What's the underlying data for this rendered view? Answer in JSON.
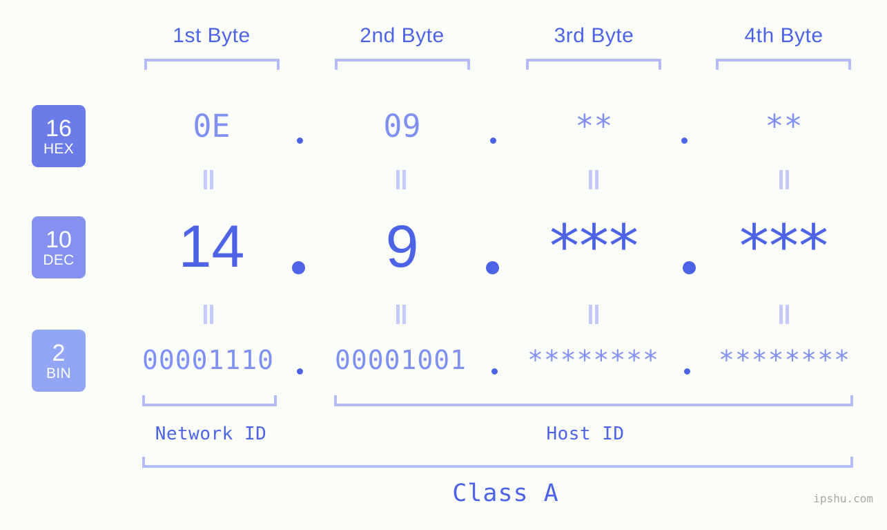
{
  "page": {
    "background_color": "#fbfdf8",
    "accent_strong": "#4d63e6",
    "accent_mid": "#8090f0",
    "accent_light": "#b3bcf9",
    "watermark": "ipshu.com"
  },
  "byte_headers": [
    {
      "label": "1st Byte"
    },
    {
      "label": "2nd Byte"
    },
    {
      "label": "3rd Byte"
    },
    {
      "label": "4th Byte"
    }
  ],
  "radix_badges": [
    {
      "number": "16",
      "name": "HEX",
      "color": "#6b7ce8"
    },
    {
      "number": "10",
      "name": "DEC",
      "color": "#8491ef"
    },
    {
      "number": "2",
      "name": "BIN",
      "color": "#93a6f5"
    }
  ],
  "rows": {
    "hex": {
      "values": [
        "0E",
        "09",
        "**",
        "**"
      ],
      "separator": "."
    },
    "dec": {
      "values": [
        "14",
        "9",
        "***",
        "***"
      ],
      "separator": "."
    },
    "bin": {
      "values": [
        "00001110",
        "00001001",
        "********",
        "********"
      ],
      "separator": "."
    }
  },
  "equality_symbol": "=",
  "segments": [
    {
      "label": "Network ID"
    },
    {
      "label": "Host ID"
    }
  ],
  "class": {
    "label": "Class A"
  }
}
